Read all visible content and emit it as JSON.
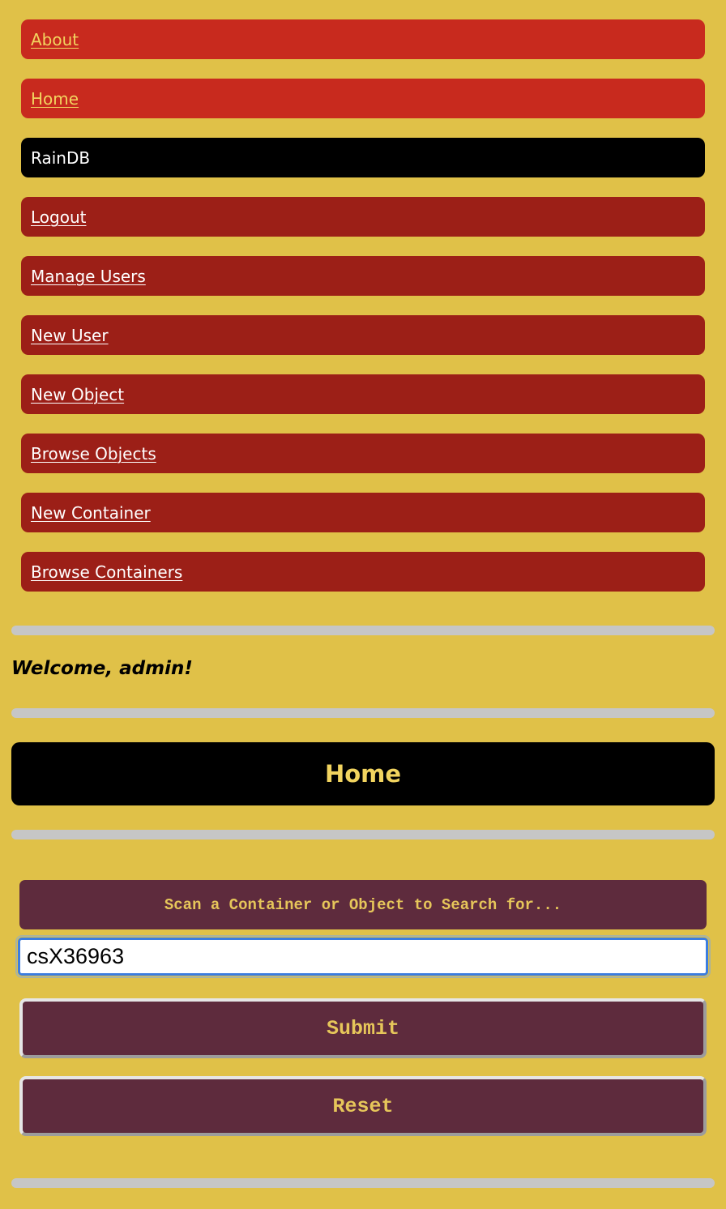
{
  "nav": {
    "items": [
      {
        "label": "About"
      },
      {
        "label": "Home"
      },
      {
        "label": "RainDB"
      },
      {
        "label": "Logout"
      },
      {
        "label": "Manage Users"
      },
      {
        "label": "New User"
      },
      {
        "label": "New Object"
      },
      {
        "label": "Browse Objects"
      },
      {
        "label": "New Container"
      },
      {
        "label": "Browse Containers"
      }
    ]
  },
  "welcome": "Welcome, admin!",
  "page_title": "Home",
  "search": {
    "label": "Scan a Container or Object to Search for...",
    "value": "csX36963"
  },
  "buttons": {
    "submit": "Submit",
    "reset": "Reset"
  },
  "colors": {
    "background": "#e0c148",
    "nav_light": "#c82a1e",
    "nav_dark": "#9c1f17",
    "nav_active": "#000000",
    "accent_text": "#f2d45f",
    "form_panel": "#5e2b3d",
    "divider": "#c6c6c6",
    "input_focus": "#3b7de0"
  }
}
